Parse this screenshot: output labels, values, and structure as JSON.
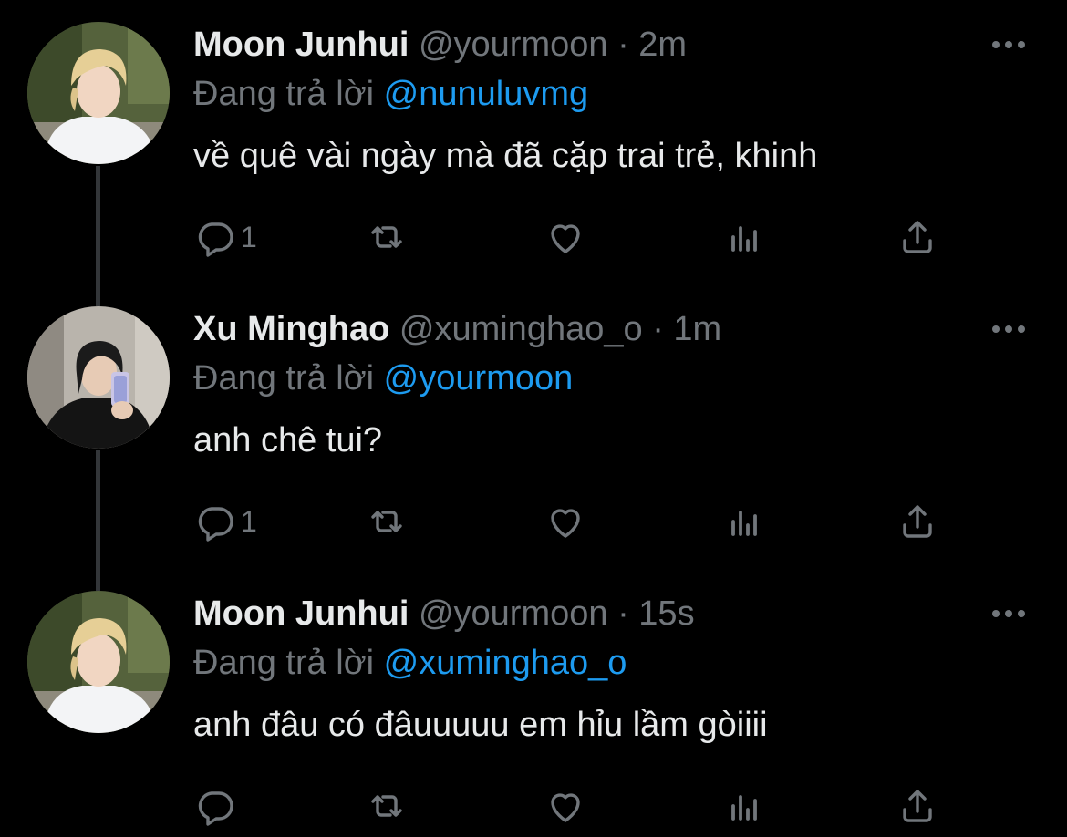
{
  "tweets": [
    {
      "name": "Moon Junhui",
      "handle": "@yourmoon",
      "separator": "·",
      "time": "2m",
      "reply_prefix": "Đang trả lời",
      "reply_to": "@nunuluvmg",
      "text": "về quê vài ngày mà đã cặp trai trẻ, khinh",
      "reply_count": "1",
      "avatar_icon": "avatar-photo-light-hair"
    },
    {
      "name": "Xu Minghao",
      "handle": "@xuminghao_o",
      "separator": "·",
      "time": "1m",
      "reply_prefix": "Đang trả lời",
      "reply_to": "@yourmoon",
      "text": "anh chê tui?",
      "reply_count": "1",
      "avatar_icon": "avatar-photo-mirror-selfie"
    },
    {
      "name": "Moon Junhui",
      "handle": "@yourmoon",
      "separator": "·",
      "time": "15s",
      "reply_prefix": "Đang trả lời",
      "reply_to": "@xuminghao_o",
      "text": "anh đâu có đâuuuuu em hỉu lầm gòiiii",
      "reply_count": "",
      "avatar_icon": "avatar-photo-light-hair"
    }
  ],
  "icons": {
    "reply": "reply-icon",
    "retweet": "retweet-icon",
    "like": "heart-icon",
    "views": "analytics-icon",
    "share": "share-icon",
    "more": "more-options-icon"
  },
  "colors": {
    "background": "#000000",
    "text": "#e7e9ea",
    "secondary": "#71767b",
    "mention": "#1d9bf0",
    "thread_line": "#333639"
  }
}
